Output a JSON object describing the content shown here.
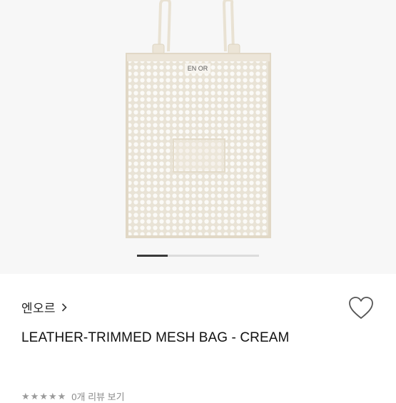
{
  "product": {
    "image_logo_text": "EN OR",
    "image_count_index": "1",
    "brand": "엔오르",
    "title": "LEATHER-TRIMMED MESH BAG - CREAM",
    "rating": 0,
    "rating_max": 5,
    "review_text": "0개 리뷰 보기"
  },
  "icons": {
    "brand_link": "chevron-right-icon",
    "favorite": "heart-outline-icon"
  },
  "colors": {
    "bag_cream": "#f1ece1",
    "bag_trim": "#e7dfcf",
    "indicator_active": "#3a3a3a",
    "indicator_track": "#dcdcdc",
    "text_primary": "#111111",
    "text_muted": "#8a8a8a"
  }
}
